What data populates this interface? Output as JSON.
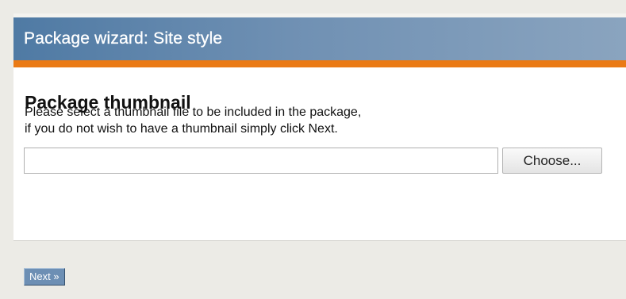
{
  "header": {
    "title": "Package wizard: Site style"
  },
  "main": {
    "heading": "Package thumbnail",
    "description_line1": "Please select a thumbnail file to be included in the package,",
    "description_line2": "if you do not wish to have a thumbnail simply click Next.",
    "file_input_value": "",
    "choose_label": "Choose..."
  },
  "footer": {
    "next_label": "Next »"
  },
  "colors": {
    "header_gradient_start": "#4f7aa4",
    "header_gradient_end": "#8aa4bf",
    "accent_orange": "#ea7a15",
    "next_button": "#6d8fb4",
    "footer_background": "#ecebe6"
  }
}
